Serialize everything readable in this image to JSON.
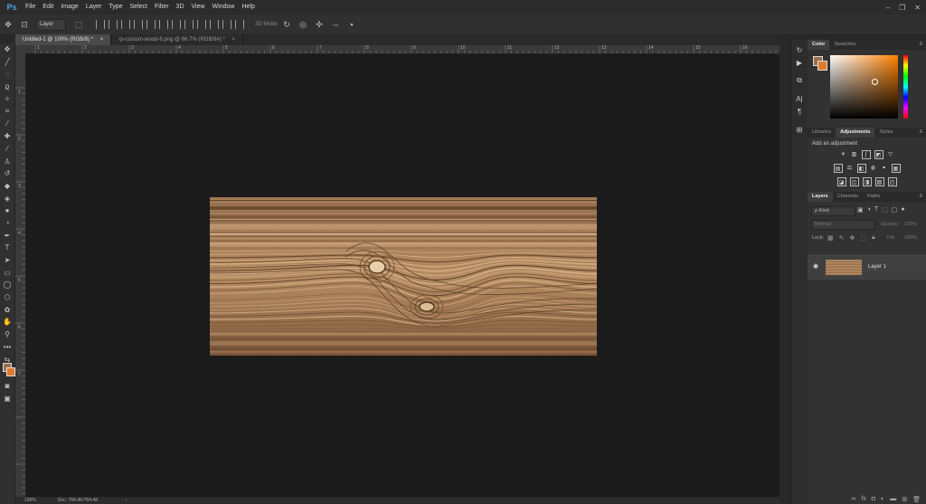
{
  "app": {
    "logo": "Ps"
  },
  "menu": [
    "File",
    "Edit",
    "Image",
    "Layer",
    "Type",
    "Select",
    "Filter",
    "3D",
    "View",
    "Window",
    "Help"
  ],
  "window_controls": {
    "minimize": "–",
    "restore": "❐",
    "close": "✕"
  },
  "options_bar": {
    "auto_select_value": "Layer",
    "mode3d_label": "3D Mode:"
  },
  "tabs": [
    {
      "label": "Untitled-1 @ 100% (RGB/8) *",
      "close": "×"
    },
    {
      "label": "rp-custom-wood-6.png @ 66.7% (RGB/8#) *",
      "close": "×"
    }
  ],
  "ruler_top_labels": [
    "1",
    "2",
    "3",
    "4",
    "5",
    "6",
    "7",
    "8",
    "9",
    "10",
    "11",
    "12",
    "13",
    "14",
    "15",
    "16"
  ],
  "ruler_left_labels": [
    "1",
    "2",
    "3",
    "4",
    "5",
    "6",
    "7"
  ],
  "status": {
    "zoom": "100%",
    "doc": "Doc: 764.4K/764.4K",
    "arrow": "›"
  },
  "colors": {
    "foreground": "#9b6f4c",
    "background": "#e07a2c",
    "accent": "#4aa3df"
  },
  "color_panel": {
    "tabs": [
      "Color",
      "Swatches"
    ]
  },
  "adjust_panel": {
    "tabs": [
      "Libraries",
      "Adjustments",
      "Styles"
    ],
    "heading": "Add an adjustment"
  },
  "layers_panel": {
    "tabs": [
      "Layers",
      "Channels",
      "Paths"
    ],
    "filter_kind": "ρ Kind",
    "blend_mode": "Normal",
    "opacity_label": "Opacity:",
    "opacity_value": "100%",
    "lock_label": "Lock:",
    "fill_label": "Fill:",
    "fill_value": "100%",
    "layers": [
      {
        "name": "Layer 1",
        "visible": true
      }
    ]
  }
}
